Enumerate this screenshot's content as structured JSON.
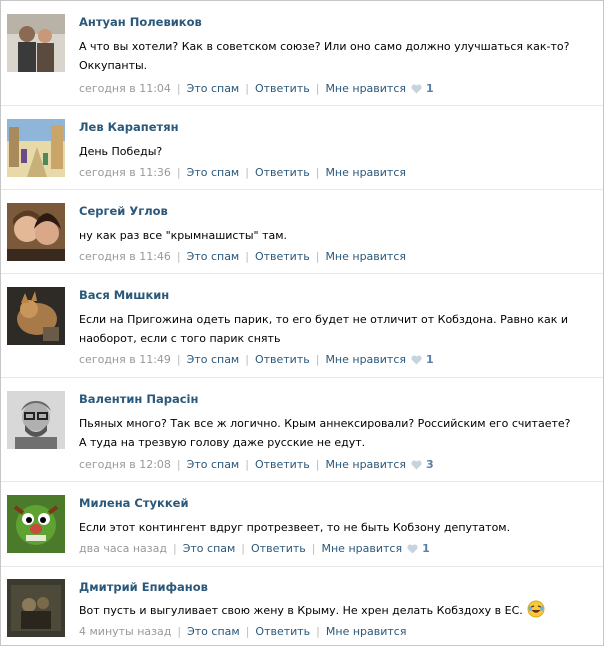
{
  "comments": [
    {
      "author": "Антуан Полевиков",
      "text": "А что вы хотели? Как в советском союзе? Или оно само должно улучшаться как-то? Оккупанты.",
      "time": "сегодня в 11:04",
      "spam_label": "Это спам",
      "reply_label": "Ответить",
      "like_label": "Мне нравится",
      "likes": "1"
    },
    {
      "author": "Лев Карапетян",
      "text": "День Победы?",
      "time": "сегодня в 11:36",
      "spam_label": "Это спам",
      "reply_label": "Ответить",
      "like_label": "Мне нравится",
      "likes": ""
    },
    {
      "author": "Сергей Углов",
      "text": "ну как раз все \"крымнашисты\" там.",
      "time": "сегодня в 11:46",
      "spam_label": "Это спам",
      "reply_label": "Ответить",
      "like_label": "Мне нравится",
      "likes": ""
    },
    {
      "author": "Вася Мишкин",
      "text": "Если на Пригожина одеть парик, то его будет не отличит от Кобздона. Равно как и наоборот, если с того парик снять",
      "time": "сегодня в 11:49",
      "spam_label": "Это спам",
      "reply_label": "Ответить",
      "like_label": "Мне нравится",
      "likes": "1"
    },
    {
      "author": "Валентин Парасін",
      "text": "Пьяных много? Так все ж логично. Крым аннексировали? Российским его считаете? А туда на трезвую голову даже русские не едут.",
      "time": "сегодня в 12:08",
      "spam_label": "Это спам",
      "reply_label": "Ответить",
      "like_label": "Мне нравится",
      "likes": "3"
    },
    {
      "author": "Милена Стуккей",
      "text": "Если этот контингент вдруг протрезвеет, то не быть Кобзону депутатом.",
      "time": "два часа назад",
      "spam_label": "Это спам",
      "reply_label": "Ответить",
      "like_label": "Мне нравится",
      "likes": "1"
    },
    {
      "author": "Дмитрий Епифанов",
      "text": "Вот пусть и выгуливает свою жену в Крыму. Не хрен делать Кобздоху в ЕС.",
      "time": "4 минуты назад",
      "spam_label": "Это спам",
      "reply_label": "Ответить",
      "like_label": "Мне нравится",
      "likes": "",
      "emoji": "laughing-tears-emoji"
    }
  ],
  "colors": {
    "author": "#2b587a",
    "link": "#2b587a",
    "meta": "#999999",
    "like_count": "#5a7ea8",
    "heart": "#c7d3df"
  }
}
